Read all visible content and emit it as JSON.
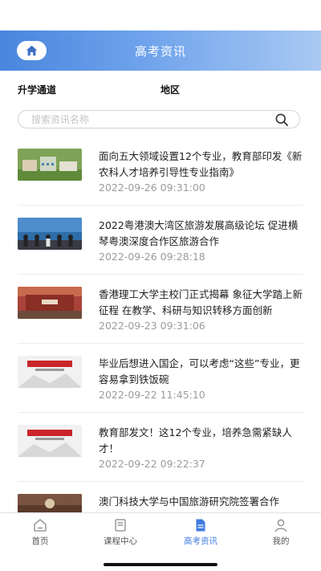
{
  "header": {
    "title": "高考资讯"
  },
  "filters": [
    {
      "label": "升学通道"
    },
    {
      "label": "地区"
    }
  ],
  "search": {
    "placeholder": "搜索资讯名称",
    "value": ""
  },
  "news": [
    {
      "title": "面向五大领域设置12个专业，教育部印发《新农科人才培养引导性专业指南》",
      "date": "2022-09-26 09:31:00"
    },
    {
      "title": "2022粤港澳大湾区旅游发展高级论坛 促进横琴粤澳深度合作区旅游合作",
      "date": "2022-09-26 09:28:18"
    },
    {
      "title": "香港理工大学主校门正式揭幕 象征大学踏上新征程 在教学、科研与知识转移方面创新",
      "date": "2022-09-23 09:31:06"
    },
    {
      "title": "毕业后想进入国企，可以考虑“这些”专业，更容易拿到铁饭碗",
      "date": "2022-09-22 11:45:10"
    },
    {
      "title": "教育部发文！这12个专业，培养急需紧缺人才！",
      "date": "2022-09-22 09:22:37"
    },
    {
      "title": "澳门科技大学与中国旅游研究院签署合作",
      "date": ""
    }
  ],
  "tabbar": [
    {
      "label": "首页",
      "icon": "home-outline-icon"
    },
    {
      "label": "课程中心",
      "icon": "book-icon"
    },
    {
      "label": "高考资讯",
      "icon": "document-icon"
    },
    {
      "label": "我的",
      "icon": "person-icon"
    }
  ],
  "colors": {
    "accent": "#3f7be0",
    "header_start": "#4a86de",
    "header_end": "#a9c9f2"
  }
}
